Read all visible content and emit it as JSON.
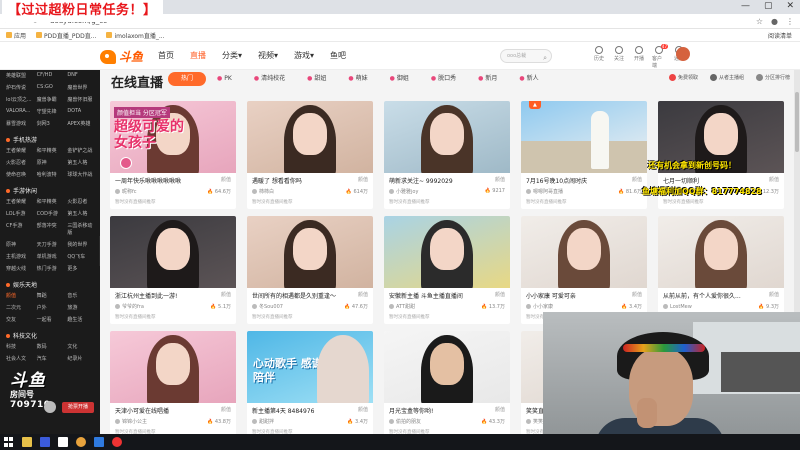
{
  "banner": "【过过超粉日常任务！】",
  "browser": {
    "url": "douyu.com/g_cc",
    "bookmarks": [
      {
        "label": "应用"
      },
      {
        "label": "PDD直播_PDD直..."
      },
      {
        "label": "imolaxom直播_..."
      }
    ],
    "bookmark_right": "阅读清单"
  },
  "header": {
    "logo": "斗鱼",
    "nav": [
      {
        "label": "首页",
        "active": false
      },
      {
        "label": "直播",
        "active": true
      },
      {
        "label": "分类▾",
        "active": false
      },
      {
        "label": "视频▾",
        "active": false
      },
      {
        "label": "游戏▾",
        "active": false
      },
      {
        "label": "鱼吧",
        "active": false
      }
    ],
    "search_placeholder": "ooo总裁",
    "icons": [
      {
        "name": "history-icon",
        "label": "历史"
      },
      {
        "name": "follow-icon",
        "label": "关注"
      },
      {
        "name": "upload-icon",
        "label": "开播"
      },
      {
        "name": "message-icon",
        "label": "客户端",
        "badge": "47"
      },
      {
        "name": "notice-icon",
        "label": "通知"
      }
    ]
  },
  "sidebar": {
    "groups": [
      {
        "title": "",
        "items": [
          "英雄联盟",
          "CF/HD",
          "DNF",
          "炉石传说",
          "CS:GO",
          "魔兽世界",
          "lol云顶之...",
          "魔兽争霸",
          "魔兽怀旧服",
          "VALORA...",
          "守望先锋",
          "DOTA",
          "暴雪游戏",
          "剑网3",
          "APEX英雄"
        ]
      },
      {
        "title": "手机热游",
        "items": [
          "王者荣耀",
          "和平精英",
          "金铲铲之战",
          "火影忍者",
          "原神",
          "第五人格",
          "使命召唤",
          "哈利波特",
          "球球大作战"
        ]
      },
      {
        "title": "手游休闲",
        "items": [
          "王者荣耀",
          "和平精英",
          "火影忍者",
          "LOL手游",
          "COD手游",
          "第五人格",
          "CF手游",
          "部落冲突",
          "三国杀移动版",
          "原神",
          "天刀手游",
          "我的世界",
          "主机游戏",
          "单机游戏",
          "QQ飞车",
          "穿越火线",
          "热门手游",
          "更多"
        ]
      },
      {
        "title": "娱乐天地",
        "items": [
          "颜值",
          "舞蹈",
          "音乐",
          "二次元",
          "户外",
          "旅游",
          "交友",
          "一起看",
          "趣生活"
        ]
      },
      {
        "title": "科技文化",
        "items": [
          "科技",
          "数码",
          "文化",
          "社会人文",
          "汽车",
          "纪录片"
        ]
      }
    ],
    "stream_logo": "斗鱼",
    "room_label": "房间号",
    "room_id": "709710",
    "highlight_button": "抢票开播"
  },
  "main": {
    "title": "在线直播",
    "tabs": [
      {
        "label": "热门",
        "active": true
      },
      {
        "label": "PK",
        "active": false
      },
      {
        "label": "清纯校花",
        "active": false
      },
      {
        "label": "甜妞",
        "active": false
      },
      {
        "label": "萌妹",
        "active": false
      },
      {
        "label": "御姐",
        "active": false
      },
      {
        "label": "脱口秀",
        "active": false
      },
      {
        "label": "新月",
        "active": false
      },
      {
        "label": "新人",
        "active": false
      }
    ],
    "tools": [
      {
        "label": "免费领取"
      },
      {
        "label": "从者主播组"
      },
      {
        "label": "分区排行榜"
      }
    ],
    "cards": [
      {
        "title": "一周年快乐啾啾啾啾啾啾",
        "tag": "颜值",
        "anchor": "昵称fc",
        "heat": "64.6万",
        "desc": "暂时没有直播间推荐",
        "hot": false,
        "theme": "pink"
      },
      {
        "title": "遇暖了 想看看你吗",
        "tag": "颜值",
        "anchor": "柿柿白",
        "heat": "614万",
        "desc": "暂时没有直播间推荐",
        "hot": false,
        "theme": "warm"
      },
      {
        "title": "萌新求关注~ 9992029",
        "tag": "颜值",
        "anchor": "小雅雅joy",
        "heat": "9217",
        "desc": "暂时没有直播间推荐",
        "hot": false,
        "theme": "outdoor"
      },
      {
        "title": "7月16号晚10点闹时庆",
        "tag": "颜值",
        "anchor": "嗯嗯阿哥直播",
        "heat": "81.6万",
        "desc": "暂时没有直播间推荐",
        "hot": true,
        "theme": "sea"
      },
      {
        "title": "七月一切顺利",
        "tag": "颜值",
        "anchor": "xxxxx",
        "heat": "12.3万",
        "desc": "暂时没有直播间推荐",
        "hot": false,
        "theme": "dark"
      },
      {
        "title": "浙江杭州主播到此一游!",
        "tag": "颜值",
        "anchor": "爷爷的fra",
        "heat": "5.1万",
        "desc": "暂时没有直播间推荐",
        "hot": false,
        "theme": "dark"
      },
      {
        "title": "世间所有的相遇都是久别重逢～",
        "tag": "颜值",
        "anchor": "冬Sou007",
        "heat": "47.6万",
        "desc": "暂时没有直播间推荐",
        "hot": false,
        "theme": "warm"
      },
      {
        "title": "安徽新主播 斗鱼主播直播间",
        "tag": "颜值",
        "anchor": "ATT甜甜",
        "heat": "13.7万",
        "desc": "暂时没有直播间推荐",
        "hot": false,
        "theme": "flower"
      },
      {
        "title": "小小家康 可爱可亲",
        "tag": "颜值",
        "anchor": "小小家康",
        "heat": "3.4万",
        "desc": "暂时没有直播间推荐",
        "hot": false,
        "theme": "light"
      },
      {
        "title": "从前从前，有个人爱你很久...",
        "tag": "颜值",
        "anchor": "LostMew",
        "heat": "9.3万",
        "desc": "暂时没有直播间推荐",
        "hot": false,
        "theme": "light"
      },
      {
        "title": "天津小可爱在线唱播",
        "tag": "颜值",
        "anchor": "锦锦小公主",
        "heat": "43.8万",
        "desc": "暂时没有直播间推荐",
        "hot": false,
        "theme": "pink"
      },
      {
        "title": "新主播第4天 8484976",
        "tag": "颜值",
        "anchor": "甜甜拌",
        "heat": "3.4万",
        "desc": "暂时没有直播间推荐",
        "hot": false,
        "theme": "banner"
      },
      {
        "title": "月光宝盒等你哟!",
        "tag": "颜值",
        "anchor": "偷拍的朋友",
        "heat": "43.3万",
        "desc": "暂时没有直播间推荐",
        "hot": false,
        "theme": "suit"
      },
      {
        "title": "笑笑直播间",
        "tag": "颜值",
        "anchor": "笑笑",
        "heat": "2.1万",
        "desc": "暂时没有直播间推荐",
        "hot": false,
        "theme": "light"
      }
    ],
    "thumb_text_1": "超级可爱的女孩子",
    "thumb_sub_1": "颜值担当 分区冠军",
    "banner_text": "心动歌手 感谢陪伴",
    "overlay_line_1": "还有机会拿到新创号码！",
    "overlay_line_2": "鱼塘福利加QQ群：817774828"
  },
  "colors": {
    "accent": "#ff6a2a",
    "sidebar_bg": "#1b1b1b",
    "banner_red": "#e8161b"
  }
}
